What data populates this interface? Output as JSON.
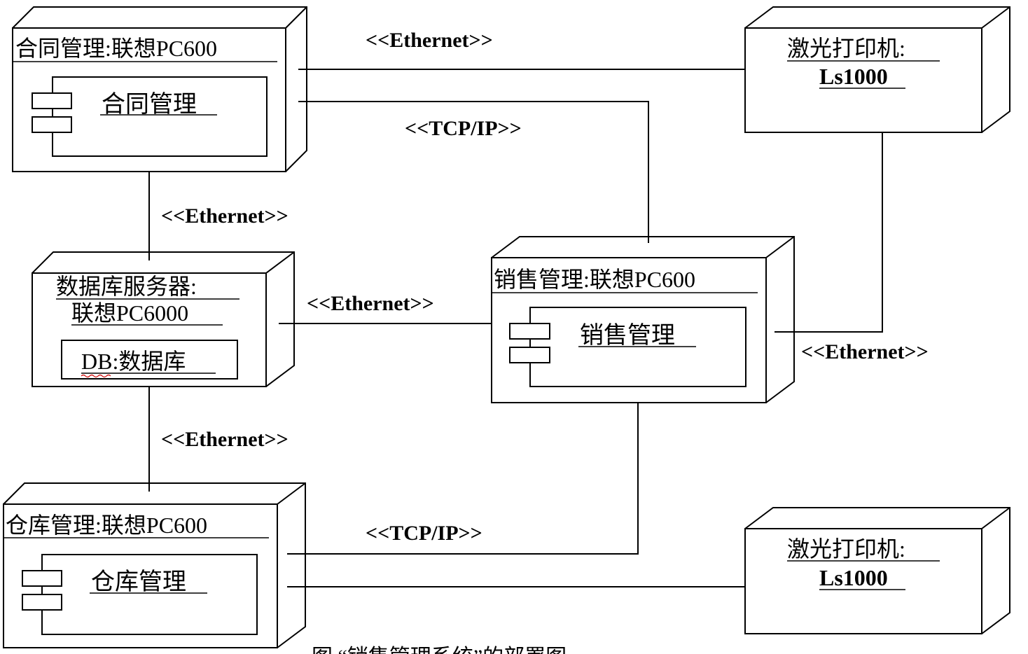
{
  "nodes": {
    "contract": {
      "title": "合同管理:联想PC600",
      "component": "合同管理"
    },
    "db_server": {
      "title_line1": "数据库服务器:",
      "title_line2": "联想PC6000",
      "artifact": "DB:数据库"
    },
    "warehouse": {
      "title": "仓库管理:联想PC600",
      "component": "仓库管理"
    },
    "sales": {
      "title": "销售管理:联想PC600",
      "component": "销售管理"
    },
    "printer_top": {
      "title_line1": "激光打印机:",
      "title_line2": "Ls1000"
    },
    "printer_bottom": {
      "title_line1": "激光打印机:",
      "title_line2": "Ls1000"
    }
  },
  "connections": {
    "contract_printer": "<<Ethernet>>",
    "contract_sales": "<<TCP/IP>>",
    "contract_db": "<<Ethernet>>",
    "db_sales": "<<Ethernet>>",
    "sales_printer": "<<Ethernet>>",
    "db_warehouse": "<<Ethernet>>",
    "warehouse_sales": "<<TCP/IP>>"
  },
  "caption": "图 “销售管理系统”的部署图"
}
